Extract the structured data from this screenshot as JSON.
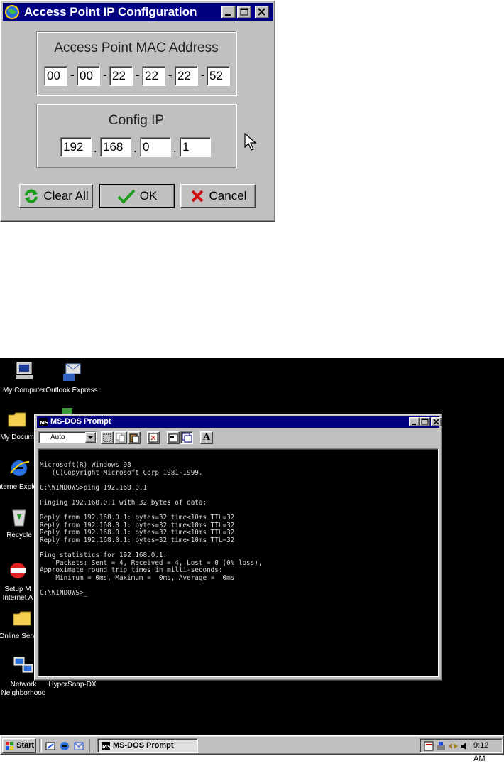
{
  "dialog": {
    "title": "Access Point IP Configuration",
    "mac_group_label": "Access Point MAC Address",
    "mac_octets": [
      "00",
      "00",
      "22",
      "22",
      "22",
      "52"
    ],
    "ip_group_label": "Config IP",
    "ip_octets": [
      "192",
      "168",
      "0",
      "1"
    ],
    "buttons": {
      "clear": "Clear All",
      "ok": "OK",
      "cancel": "Cancel"
    }
  },
  "desktop": {
    "icons": {
      "my_computer": "My Computer",
      "outlook": "Outlook Express",
      "my_documents": "My Docum",
      "internet_explorer": "Interne Explore",
      "recycle": "Recycle",
      "msn": "Setup M Internet A",
      "online": "Online Service",
      "network": "Network Neighborhood",
      "hypersnap": "HyperSnap-DX"
    }
  },
  "dos_window": {
    "title": "MS-DOS Prompt",
    "font_size": "Auto",
    "lines": [
      "Microsoft(R) Windows 98",
      "   (C)Copyright Microsoft Corp 1981-1999.",
      "",
      "C:\\WINDOWS>ping 192.168.0.1",
      "",
      "Pinging 192.168.0.1 with 32 bytes of data:",
      "",
      "Reply from 192.168.0.1: bytes=32 time<10ms TTL=32",
      "Reply from 192.168.0.1: bytes=32 time<10ms TTL=32",
      "Reply from 192.168.0.1: bytes=32 time<10ms TTL=32",
      "Reply from 192.168.0.1: bytes=32 time<10ms TTL=32",
      "",
      "Ping statistics for 192.168.0.1:",
      "    Packets: Sent = 4, Received = 4, Lost = 0 (0% loss),",
      "Approximate round trip times in milli-seconds:",
      "    Minimum = 0ms, Maximum =  0ms, Average =  0ms",
      "",
      "C:\\WINDOWS>_"
    ]
  },
  "taskbar": {
    "start": "Start",
    "task": "MS-DOS Prompt",
    "clock": "9:12 AM"
  }
}
